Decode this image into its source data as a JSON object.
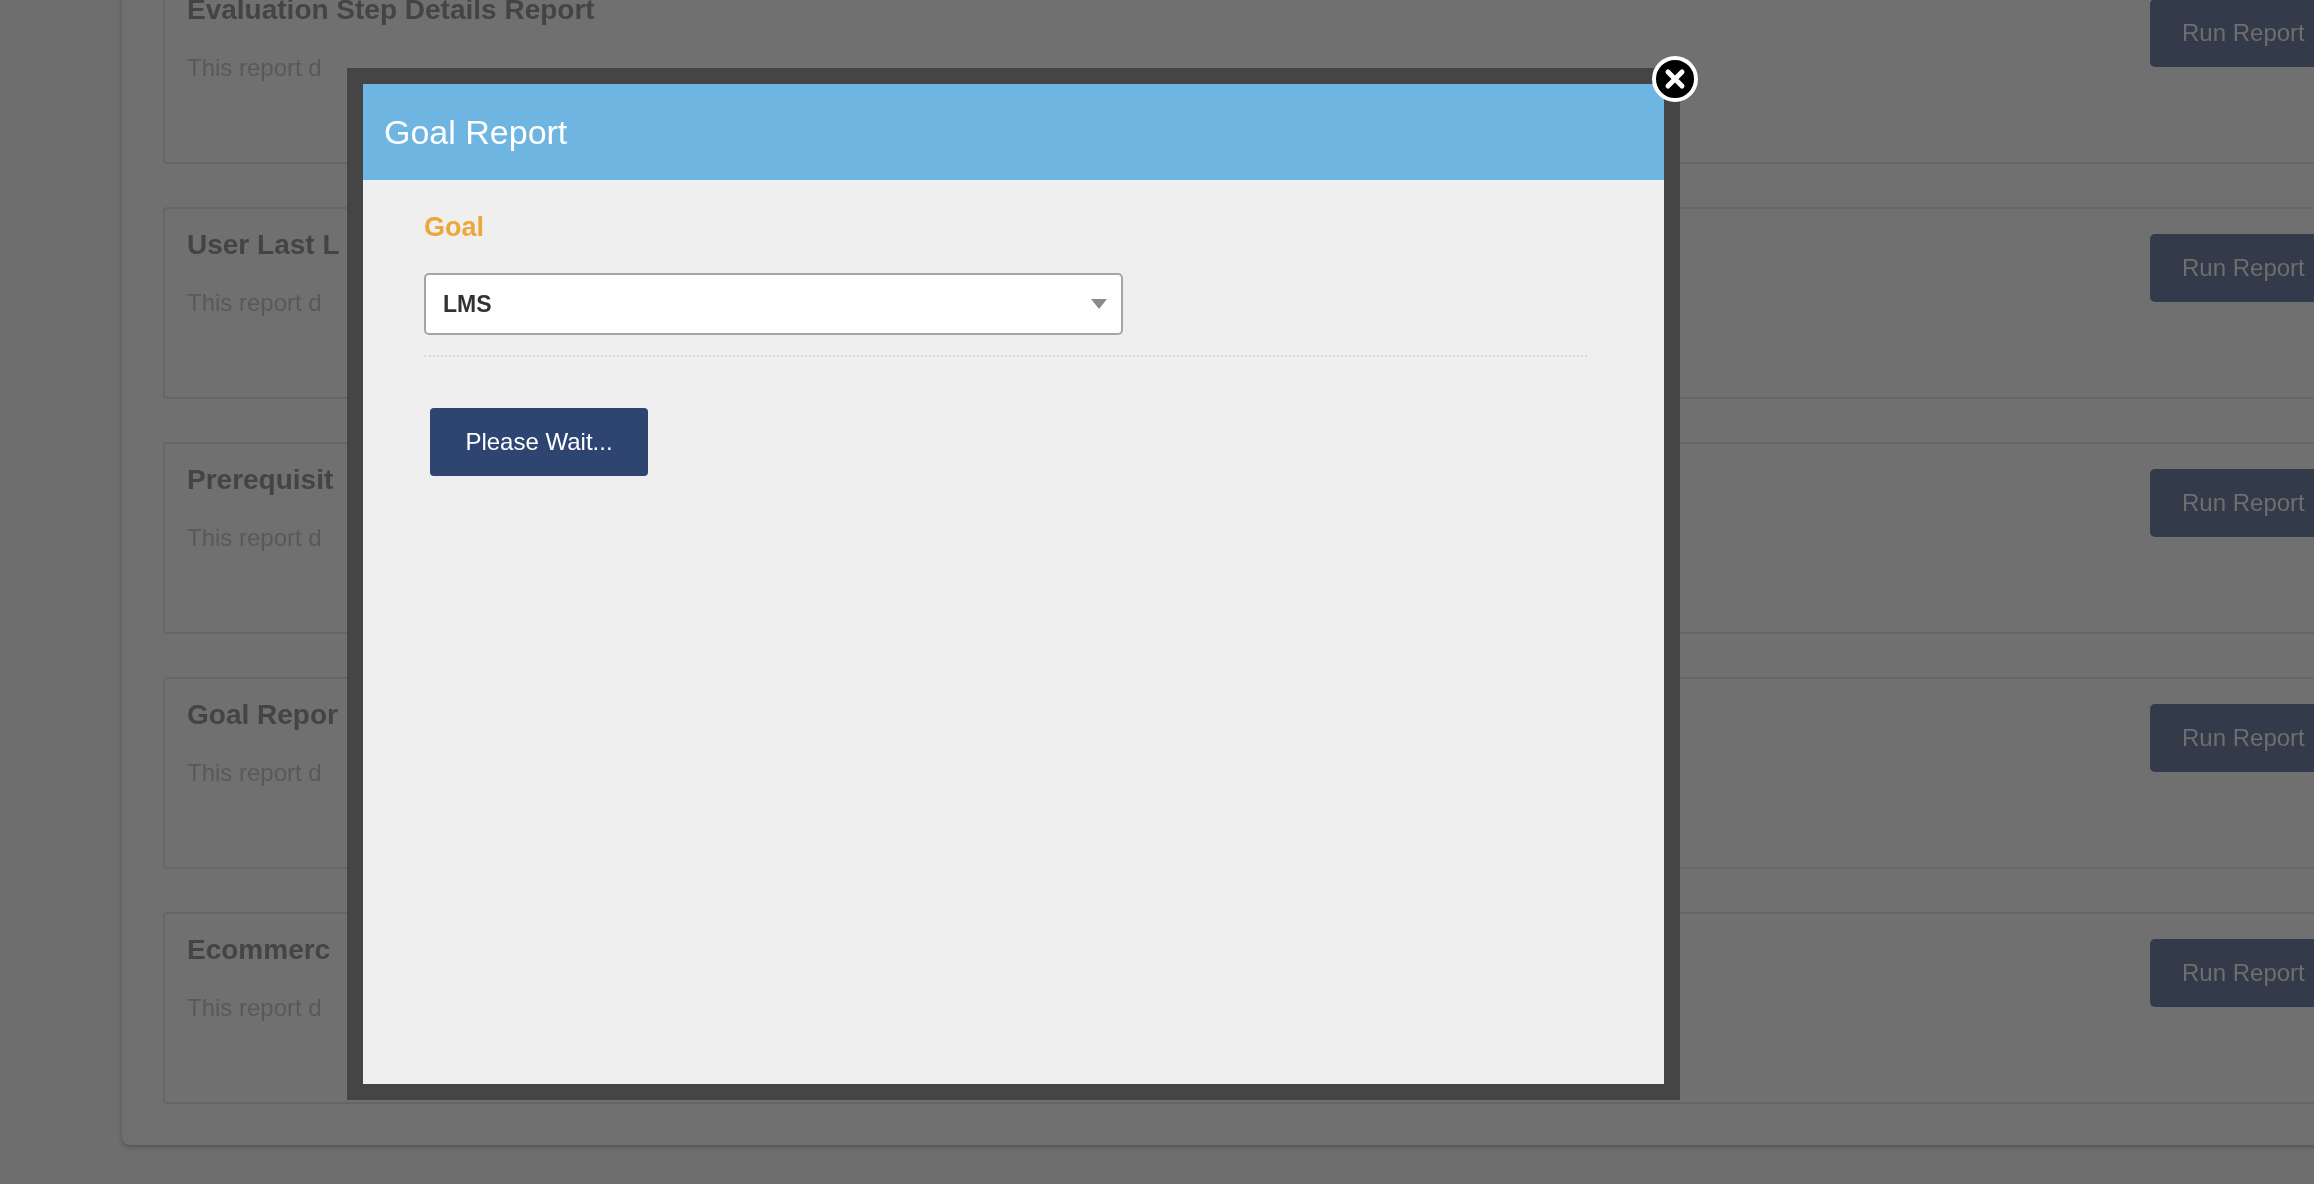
{
  "report_cards": [
    {
      "title": "Evaluation Step Details Report",
      "description": "This report d",
      "button": "Run Report"
    },
    {
      "title": "User Last L",
      "description": "This report d",
      "button": "Run Report"
    },
    {
      "title": "Prerequisit",
      "description": "This report d",
      "button": "Run Report"
    },
    {
      "title": "Goal Repor",
      "description": "This report d",
      "button": "Run Report"
    },
    {
      "title": "Ecommerc",
      "description": "This report d",
      "button": "Run Report"
    }
  ],
  "dialog": {
    "title": "Goal Report",
    "field_label": "Goal",
    "select_value": "LMS",
    "button": "Please Wait..."
  }
}
